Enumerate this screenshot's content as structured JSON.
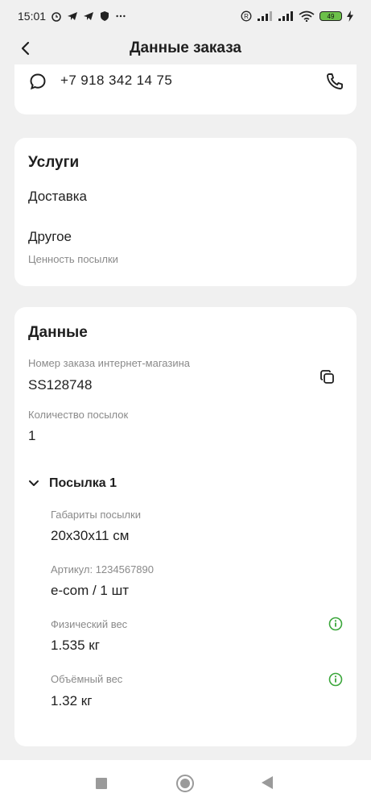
{
  "status_bar": {
    "time": "15:01",
    "battery": "49"
  },
  "header": {
    "title": "Данные заказа"
  },
  "contact": {
    "phone": "+7 918 342 14 75"
  },
  "services": {
    "title": "Услуги",
    "items": [
      "Доставка",
      "Другое"
    ],
    "other_sub": "Ценность посылки"
  },
  "data": {
    "title": "Данные",
    "order_number_label": "Номер заказа интернет-магазина",
    "order_number": "SS128748",
    "parcels_count_label": "Количество посылок",
    "parcels_count": "1",
    "parcel": {
      "title": "Посылка 1",
      "dimensions_label": "Габариты посылки",
      "dimensions": "20x30x11 см",
      "article_label": "Артикул: 1234567890",
      "article_value": "e-com / 1 шт",
      "physical_weight_label": "Физический вес",
      "physical_weight": "1.535 кг",
      "volume_weight_label": "Объёмный вес",
      "volume_weight": "1.32 кг"
    }
  },
  "colors": {
    "accent_green": "#3aa63a",
    "background": "#f0f0f0",
    "card": "#ffffff"
  }
}
